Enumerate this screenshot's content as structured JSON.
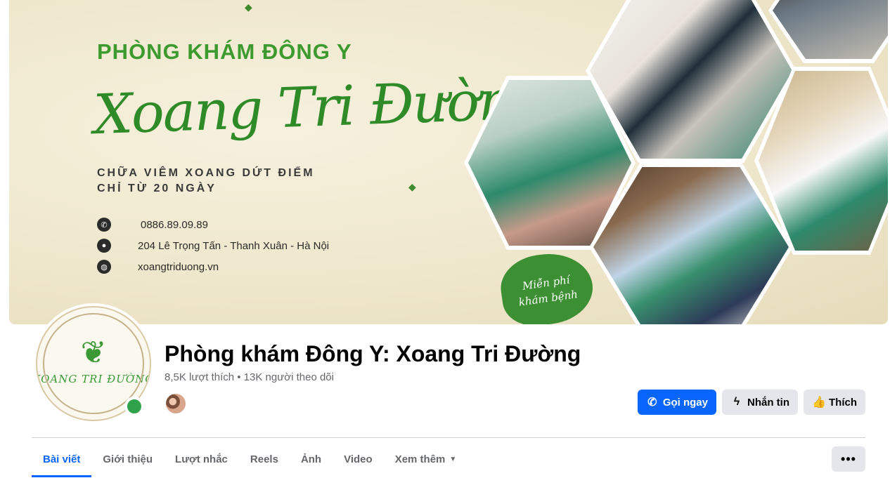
{
  "cover": {
    "line1": "PHÒNG KHÁM ĐÔNG Y",
    "script_title": "Xoang Tri Đường",
    "tagline_1": "CHỮA VIÊM XOANG DỨT ĐIỂM",
    "tagline_2": "CHỈ TỪ 20 NGÀY",
    "phone": "0886.89.09.89",
    "address": "204 Lê Trọng Tấn - Thanh Xuân - Hà Nội",
    "website": "xoangtriduong.vn",
    "badge_1": "Miễn phí",
    "badge_2": "khám bệnh"
  },
  "avatar": {
    "logo_text": "XOANG TRI ĐƯỜNG"
  },
  "page": {
    "name": "Phòng khám Đông Y: Xoang Tri Đường",
    "stats": "8,5K lượt thích • 13K người theo dõi"
  },
  "actions": {
    "call": "Gọi ngay",
    "message": "Nhắn tin",
    "like": "Thích"
  },
  "tabs": [
    {
      "label": "Bài viết",
      "active": true
    },
    {
      "label": "Giới thiệu"
    },
    {
      "label": "Lượt nhắc"
    },
    {
      "label": "Reels"
    },
    {
      "label": "Ảnh"
    },
    {
      "label": "Video"
    },
    {
      "label": "Xem thêm"
    }
  ],
  "colors": {
    "accent": "#0866ff",
    "brand_green": "#3c8f33",
    "online": "#31a24c"
  }
}
